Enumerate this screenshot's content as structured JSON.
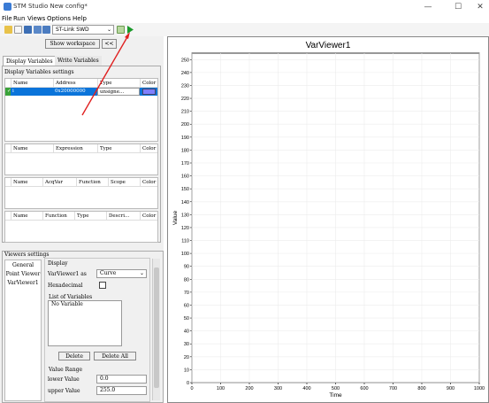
{
  "window": {
    "title": "STM Studio New config*",
    "controls": {
      "minimize": "—",
      "maximize": "☐",
      "close": "✕"
    }
  },
  "menu": [
    "File",
    "Run",
    "Views",
    "Options",
    "Help"
  ],
  "toolbar": {
    "probe": "ST-Link SWD",
    "icons": [
      "new-icon",
      "open-icon",
      "save-icon",
      "save-as-icon",
      "settings-icon",
      "import-icon",
      "play-icon"
    ]
  },
  "left": {
    "show_workspace": "Show workspace",
    "collapse": "<<",
    "tabs": [
      "Display Variables",
      "Write Variables"
    ],
    "display_settings_title": "Display Variables settings",
    "var_table": {
      "headers": [
        "Name",
        "Address",
        "Type",
        "Color"
      ],
      "row": {
        "check": "✓",
        "name": "i",
        "address": "0x20000000",
        "type": "unsigne...",
        "color": "#7f7fff"
      }
    },
    "expr_table": {
      "headers": [
        "Name",
        "Expression",
        "Type",
        "Color"
      ]
    },
    "acq_table": {
      "headers": [
        "Name",
        "AcqVar",
        "Function",
        "Scope",
        "Color"
      ]
    },
    "func_table": {
      "headers": [
        "Name",
        "Function",
        "Type",
        "Descri...",
        "Color"
      ]
    }
  },
  "viewers": {
    "title": "Viewers settings",
    "list": [
      "General",
      "Point Viewer",
      "VarViewer1"
    ],
    "display_label": "Display",
    "viewer_as_label": "VarViewer1 as",
    "viewer_as_value": "Curve",
    "hex_label": "Hexadecimal",
    "list_of_variables_label": "List of Variables",
    "list_placeholder": "No Variable",
    "delete": "Delete",
    "delete_all": "Delete All",
    "value_range_label": "Value Range",
    "lower_label": "lower Value",
    "lower_value": "0.0",
    "upper_label": "upper Value",
    "upper_value": "255.0"
  },
  "chart_data": {
    "type": "line",
    "title": "VarViewer1",
    "xlabel": "Time",
    "ylabel": "Value",
    "xlim": [
      0,
      1000
    ],
    "ylim": [
      0,
      255
    ],
    "x_ticks": [
      0,
      100,
      200,
      300,
      400,
      500,
      600,
      700,
      800,
      900,
      1000
    ],
    "y_ticks": [
      0,
      10,
      20,
      30,
      40,
      50,
      60,
      70,
      80,
      90,
      100,
      110,
      120,
      130,
      140,
      150,
      160,
      170,
      180,
      190,
      200,
      210,
      220,
      230,
      240,
      250
    ],
    "grid": true,
    "series": []
  },
  "colors": {
    "accent": "#0a74da",
    "play": "#1a9a2a",
    "annotation_arrow": "#e02020"
  }
}
